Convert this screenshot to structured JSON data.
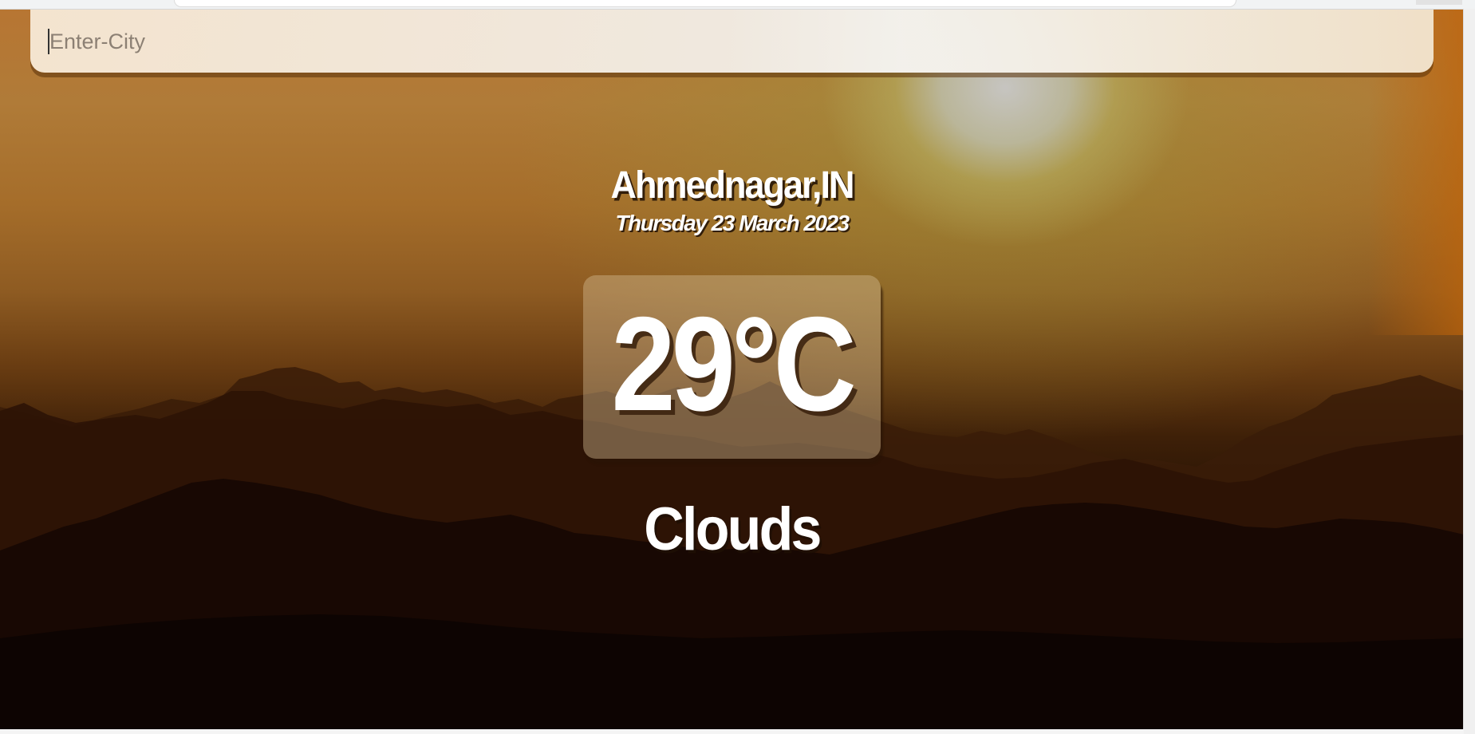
{
  "search": {
    "placeholder": "Enter-City",
    "value": ""
  },
  "weather": {
    "location": "Ahmednagar,IN",
    "date": "Thursday 23 March 2023",
    "temperature": "29°C",
    "condition": "Clouds"
  },
  "colors": {
    "sky_top": "#b87532",
    "sun_glow": "#c8c8c8",
    "mountain_far": "#7a3e10",
    "mountain_mid": "#4a2208",
    "mountain_near": "#1a0a02",
    "text": "#ffffff",
    "search_bar": "#f2ece4"
  }
}
